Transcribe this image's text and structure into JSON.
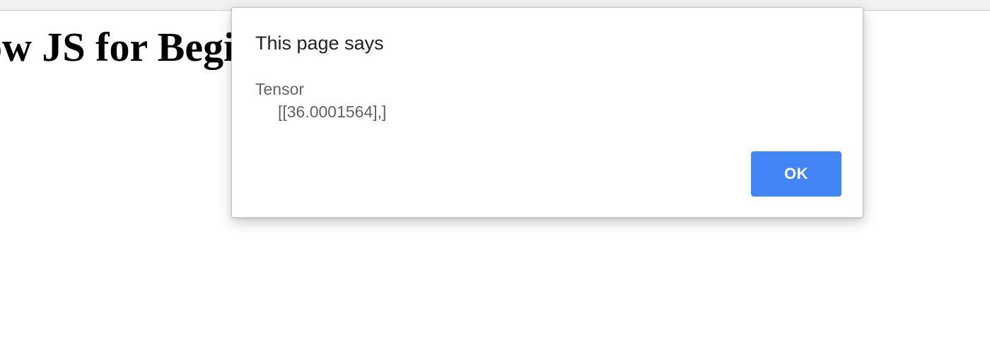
{
  "page": {
    "heading": "ow JS for Beginners"
  },
  "alert": {
    "title": "This page says",
    "message_lines": [
      "Tensor",
      "     [[36.0001564],]"
    ],
    "ok_label": "OK",
    "ok_color": "#4285f4"
  }
}
